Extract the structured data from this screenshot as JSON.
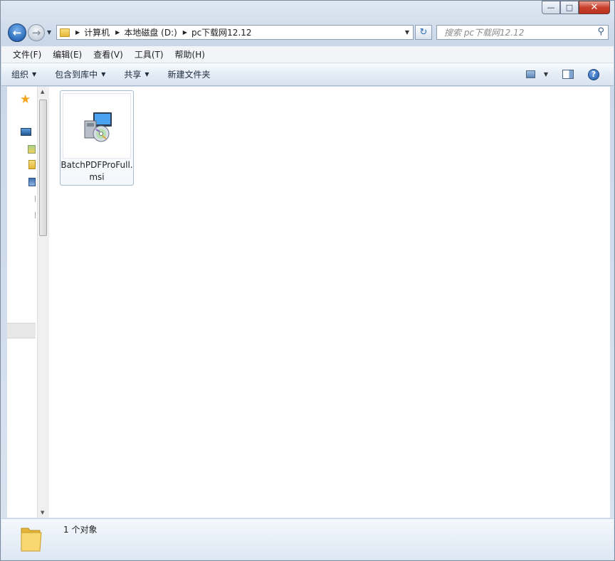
{
  "window": {
    "title": "",
    "controls": {
      "minimize": "—",
      "maximize": "□",
      "close": "✕"
    }
  },
  "address": {
    "crumbs": [
      "计算机",
      "本地磁盘 (D:)",
      "pc下载网12.12"
    ],
    "search_placeholder": "搜索 pc下载网12.12"
  },
  "menu": [
    "文件(F)",
    "编辑(E)",
    "查看(V)",
    "工具(T)",
    "帮助(H)"
  ],
  "toolbar": {
    "organize": "组织",
    "include_in_library": "包含到库中",
    "share": "共享",
    "new_folder": "新建文件夹"
  },
  "files": [
    {
      "name": "BatchPDFProFull.msi",
      "icon": "msi-installer-icon",
      "selected": true
    }
  ],
  "status": {
    "count_text": "1 个对象"
  },
  "colors": {
    "accent": "#2c6bb9",
    "selection_border": "#a6bdd5",
    "close_button": "#c7402c"
  }
}
